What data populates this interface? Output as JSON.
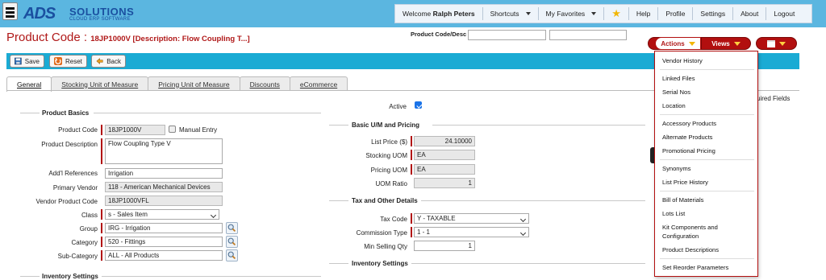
{
  "brand": {
    "ads": "ADS",
    "solutions": "SOLUTIONS",
    "tagline": "CLOUD ERP SOFTWARE"
  },
  "topnav": {
    "welcome_prefix": "Welcome ",
    "user": "Ralph Peters",
    "shortcuts": "Shortcuts",
    "favorites": "My Favorites",
    "help": "Help",
    "profile": "Profile",
    "settings": "Settings",
    "about": "About",
    "logout": "Logout"
  },
  "header": {
    "title": "Product Code : ",
    "subtitle": "18JP1000V [Description: Flow Coupling T...]",
    "search_label": "Product Code/Desc",
    "search_value_1": "",
    "search_value_2": ""
  },
  "action_buttons": {
    "actions": "Actions",
    "views": "Views"
  },
  "toolbar": {
    "save": "Save",
    "reset": "Reset",
    "back": "Back"
  },
  "tabs": [
    "General",
    "Stocking Unit of Measure",
    "Pricing Unit of Measure",
    "Discounts",
    "eCommerce"
  ],
  "product_basics": {
    "heading": "Product Basics",
    "product_code_label": "Product Code",
    "product_code": "18JP1000V",
    "manual_entry_label": "Manual Entry",
    "description_label": "Product Description",
    "description": "Flow Coupling Type V",
    "addl_refs_label": "Add'l References",
    "addl_refs": "Irrigation",
    "primary_vendor_label": "Primary Vendor",
    "primary_vendor": "118 - American Mechanical Devices",
    "vendor_product_code_label": "Vendor Product Code",
    "vendor_product_code": "18JP1000VFL",
    "class_label": "Class",
    "class": "s - Sales Item",
    "group_label": "Group",
    "group": "IRG - Irrigation",
    "category_label": "Category",
    "category": "520 - Fittings",
    "subcategory_label": "Sub-Category",
    "subcategory": "ALL - All Products"
  },
  "inventory_settings_left": "Inventory Settings",
  "active_label": "Active",
  "basic_um": {
    "heading": "Basic U/M and Pricing",
    "list_price_label": "List Price ($)",
    "list_price": "24.10000",
    "stocking_uom_label": "Stocking UOM",
    "stocking_uom": "EA",
    "pricing_uom_label": "Pricing UOM",
    "pricing_uom": "EA",
    "uom_ratio_label": "UOM Ratio",
    "uom_ratio": "1"
  },
  "tax": {
    "heading": "Tax and Other Details",
    "tax_code_label": "Tax Code",
    "tax_code": "Y - TAXABLE",
    "commission_type_label": "Commission Type",
    "commission_type": "1 - 1",
    "min_selling_qty_label": "Min Selling Qty",
    "min_selling_qty": "1"
  },
  "inventory_settings_right": "Inventory Settings",
  "required_fields": "uired Fields",
  "actions_menu": [
    "Vendor History",
    "Linked Files",
    "Serial Nos",
    "Location",
    "Accessory Products",
    "Alternate Products",
    "Promotional Pricing",
    "Synonyms",
    "List Price History",
    "Bill of Materials",
    "Lots List",
    "Kit Components and",
    "Configuration",
    "Product Descriptions",
    "Set Reorder Parameters"
  ],
  "colors": {
    "topbar": "#5bb6e0",
    "accent_red": "#b20f0f",
    "bluebar": "#1aabd4"
  }
}
